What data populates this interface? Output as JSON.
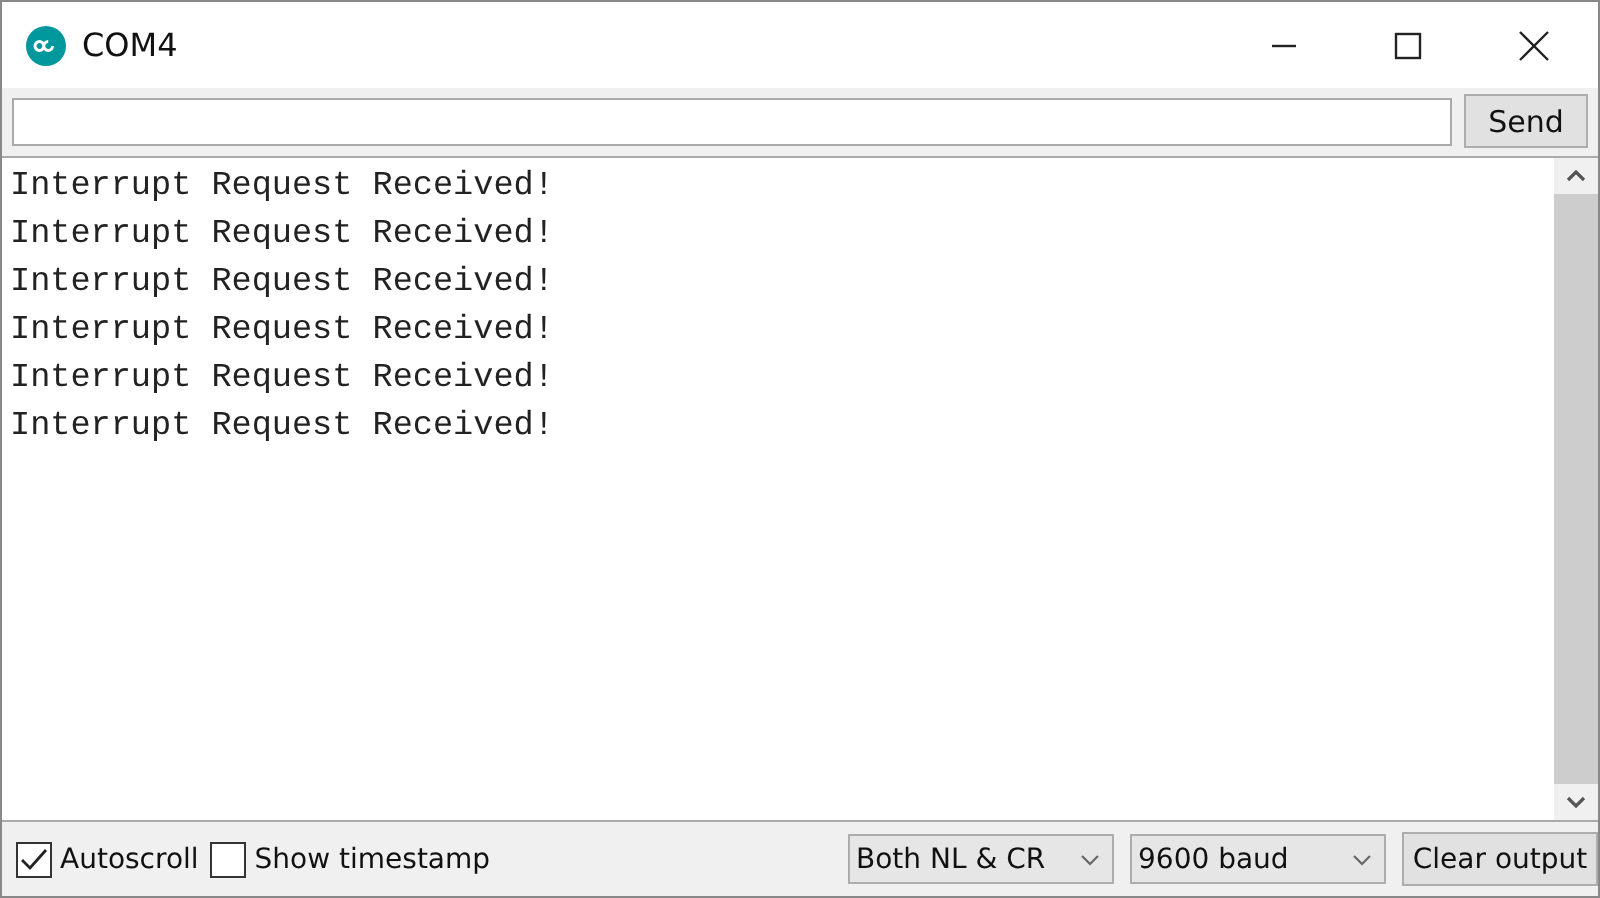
{
  "window": {
    "title": "COM4"
  },
  "send_button": "Send",
  "output_lines": [
    "Interrupt Request Received!",
    "Interrupt Request Received!",
    "Interrupt Request Received!",
    "Interrupt Request Received!",
    "Interrupt Request Received!",
    "Interrupt Request Received!"
  ],
  "options": [
    {
      "label": "Autoscroll",
      "checked": true
    },
    {
      "label": "Show timestamp",
      "checked": false
    }
  ],
  "line_ending": "Both NL & CR",
  "baud_rate": "9600 baud",
  "clear_button": "Clear output"
}
